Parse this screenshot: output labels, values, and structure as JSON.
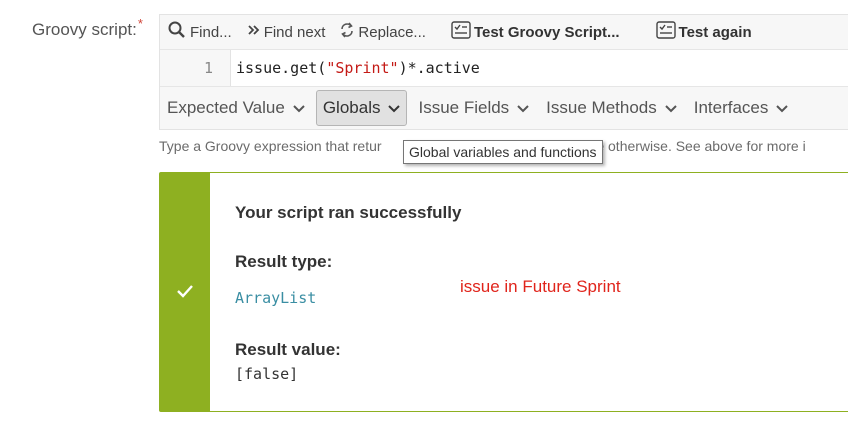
{
  "field": {
    "label": "Groovy script:",
    "required_marker": "*"
  },
  "toolbar": {
    "find": "Find...",
    "find_next": "Find next",
    "replace": "Replace...",
    "test_script": "Test Groovy Script...",
    "test_again": "Test again"
  },
  "editor": {
    "line_number": "1",
    "code_prefix": "issue.get(",
    "code_string": "\"Sprint\"",
    "code_suffix": ")*.active"
  },
  "menu": {
    "items": [
      {
        "label": "Expected Value"
      },
      {
        "label": "Globals"
      },
      {
        "label": "Issue Fields"
      },
      {
        "label": "Issue Methods"
      },
      {
        "label": "Interfaces"
      }
    ]
  },
  "description": {
    "left": "Type a Groovy expression that retur",
    "right": "ue otherwise. See above for more i"
  },
  "tooltip": "Global variables and functions",
  "result": {
    "title": "Your script ran successfully",
    "type_label": "Result type:",
    "type_value": "ArrayList",
    "value_label": "Result value:",
    "value": "[false]",
    "annotation": "issue in Future Sprint"
  },
  "colors": {
    "success": "#8eb021",
    "annotation": "#e0241b",
    "type_text": "#3a8ea3"
  }
}
